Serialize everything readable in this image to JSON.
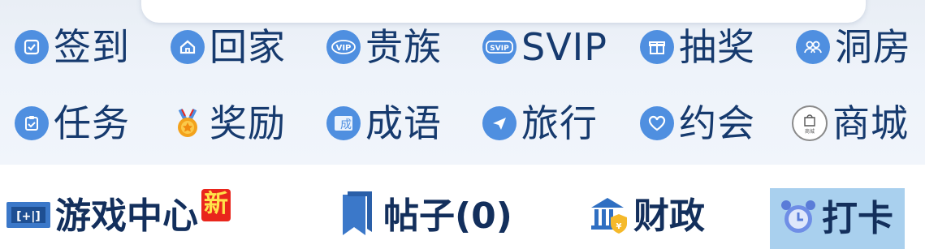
{
  "menu": {
    "row1": [
      {
        "label": "签到",
        "icon": "checkin-icon"
      },
      {
        "label": "回家",
        "icon": "home-icon"
      },
      {
        "label": "贵族",
        "icon": "vip-icon"
      },
      {
        "label": "SVIP",
        "icon": "svip-icon"
      },
      {
        "label": "抽奖",
        "icon": "gift-icon"
      },
      {
        "label": "洞房",
        "icon": "couple-icon"
      }
    ],
    "row2": [
      {
        "label": "任务",
        "icon": "task-icon"
      },
      {
        "label": "奖励",
        "icon": "medal-icon"
      },
      {
        "label": "成语",
        "icon": "idiom-icon"
      },
      {
        "label": "旅行",
        "icon": "travel-icon"
      },
      {
        "label": "约会",
        "icon": "heart-icon"
      },
      {
        "label": "商城",
        "icon": "shop-icon"
      }
    ],
    "vip_icon_text": "VIP",
    "svip_icon_text": "SVIP",
    "idiom_icon_text": "成",
    "shop_icon_text": "商城"
  },
  "toolbar": {
    "game_center": "游戏中心",
    "new_badge": "新",
    "posts": "帖子(0)",
    "finance": "财政",
    "checkin": "打卡"
  },
  "colors": {
    "icon_blue": "#4f8fe0",
    "label_dark_blue": "#163a6e",
    "toolbar_text": "#132f5c",
    "badge_red": "#e9261c",
    "checkin_bg": "#a9d0ee"
  }
}
